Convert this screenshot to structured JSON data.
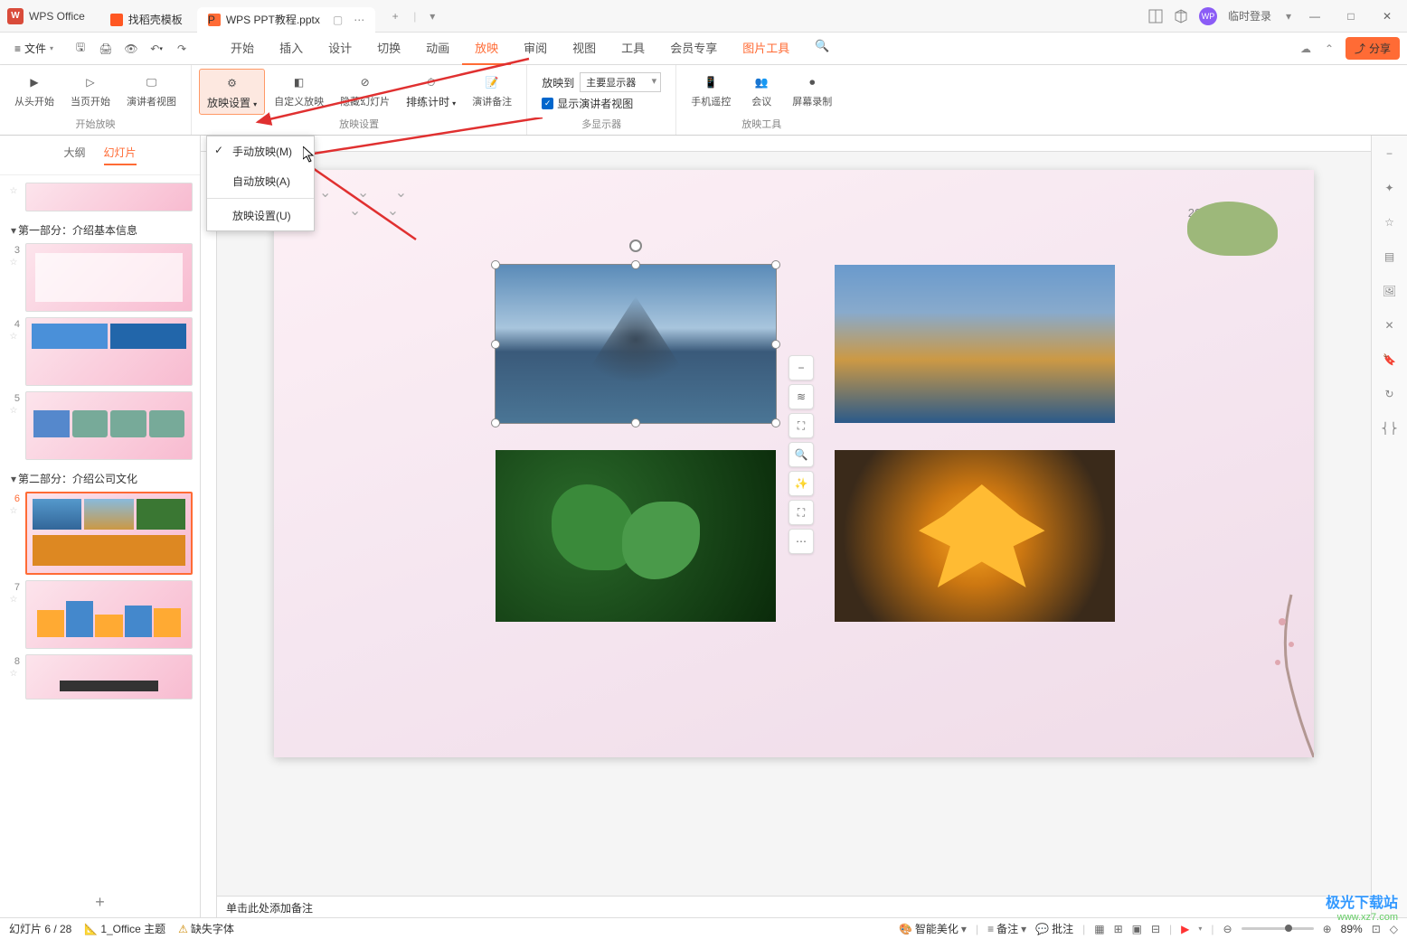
{
  "titlebar": {
    "app_name": "WPS Office",
    "tabs": [
      {
        "label": "找稻壳模板",
        "icon": "template"
      },
      {
        "label": "WPS PPT教程.pptx",
        "icon": "ppt",
        "active": true
      }
    ],
    "login_status": "临时登录"
  },
  "menubar": {
    "file_label": "文件",
    "main_tabs": [
      "开始",
      "插入",
      "设计",
      "切换",
      "动画",
      "放映",
      "审阅",
      "视图",
      "工具",
      "会员专享"
    ],
    "active_tab": "放映",
    "tool_tab": "图片工具",
    "share_label": "分享"
  },
  "ribbon": {
    "group1": {
      "label": "开始放映",
      "buttons": [
        {
          "label": "从头开始",
          "icon": "play-start"
        },
        {
          "label": "当页开始",
          "icon": "play-current"
        },
        {
          "label": "演讲者视图",
          "icon": "presenter"
        }
      ]
    },
    "group2": {
      "label": "放映设置",
      "buttons": [
        {
          "label": "放映设置",
          "icon": "settings",
          "active": true,
          "dropdown": true
        },
        {
          "label": "自定义放映",
          "icon": "custom"
        },
        {
          "label": "隐藏幻灯片",
          "icon": "hide"
        },
        {
          "label": "排练计时",
          "icon": "timer"
        },
        {
          "label": "演讲备注",
          "icon": "notes"
        }
      ]
    },
    "group3": {
      "label": "多显示器",
      "select_label": "放映到",
      "select_value": "主要显示器",
      "check_label": "显示演讲者视图"
    },
    "group4": {
      "label": "放映工具",
      "buttons": [
        {
          "label": "手机遥控",
          "icon": "mobile"
        },
        {
          "label": "会议",
          "icon": "meeting"
        },
        {
          "label": "屏幕录制",
          "icon": "record"
        }
      ]
    }
  },
  "dropdown": {
    "items": [
      {
        "label": "手动放映(M)",
        "checked": true
      },
      {
        "label": "自动放映(A)",
        "checked": false
      }
    ],
    "sep_item": {
      "label": "放映设置(U)"
    }
  },
  "left_panel": {
    "tabs": [
      "大纲",
      "幻灯片"
    ],
    "active_tab": "幻灯片",
    "sections": [
      {
        "label": "第一部分：介绍基本信息",
        "slides": [
          3,
          4,
          5
        ]
      },
      {
        "label": "第二部分：介绍公司文化",
        "slides": [
          6,
          7,
          8
        ]
      }
    ],
    "current_slide": 6
  },
  "canvas": {
    "date": "2023-8-30"
  },
  "notes": {
    "placeholder": "单击此处添加备注"
  },
  "statusbar": {
    "slide_info": "幻灯片 6 / 28",
    "theme": "1_Office 主题",
    "font_warning": "缺失字体",
    "smart_beautify": "智能美化",
    "notes_btn": "备注",
    "comment_btn": "批注",
    "zoom": "89%"
  },
  "watermark": {
    "main": "极光下载站",
    "sub": "www.xz7.com"
  }
}
